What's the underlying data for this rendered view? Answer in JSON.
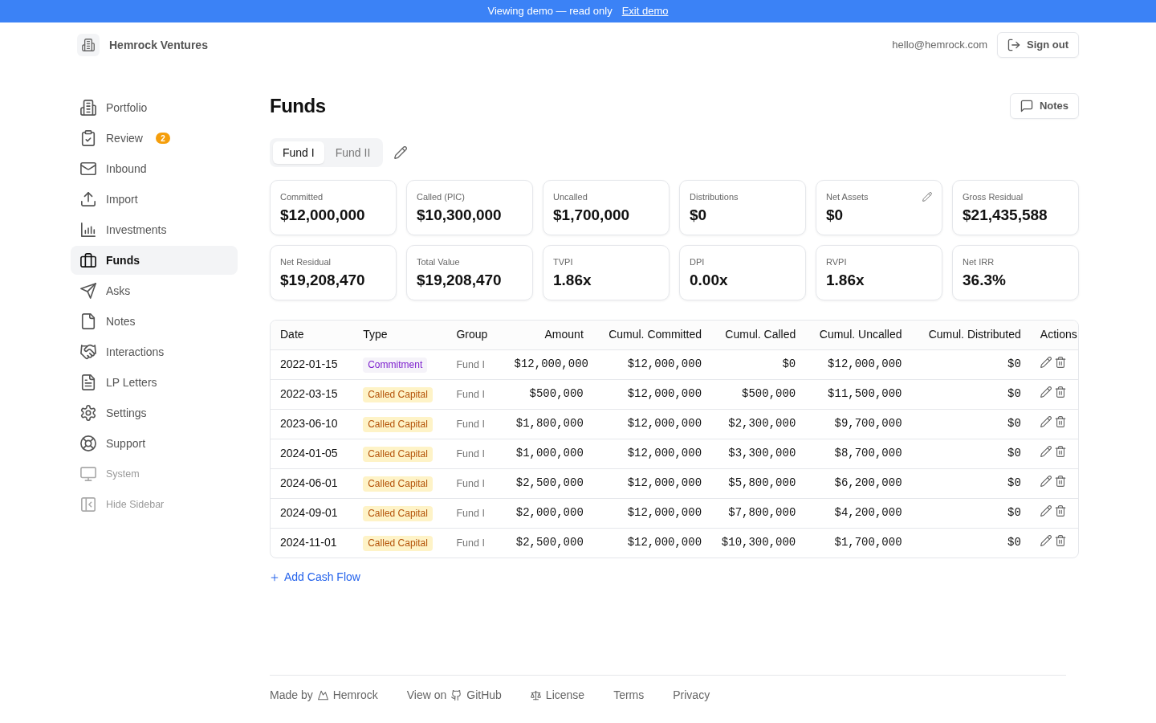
{
  "demo_banner": {
    "text": "Viewing demo — read only",
    "link": "Exit demo"
  },
  "header": {
    "brand": "Hemrock Ventures",
    "email": "hello@hemrock.com",
    "sign_out": "Sign out"
  },
  "sidebar": {
    "items": [
      {
        "label": "Portfolio",
        "selected": false
      },
      {
        "label": "Review",
        "selected": false,
        "badge": "2"
      },
      {
        "label": "Inbound",
        "selected": false
      },
      {
        "label": "Import",
        "selected": false
      },
      {
        "label": "Investments",
        "selected": false
      },
      {
        "label": "Funds",
        "selected": true
      },
      {
        "label": "Asks",
        "selected": false
      },
      {
        "label": "Notes",
        "selected": false
      },
      {
        "label": "Interactions",
        "selected": false
      },
      {
        "label": "LP Letters",
        "selected": false
      },
      {
        "label": "Settings",
        "selected": false
      },
      {
        "label": "Support",
        "selected": false
      }
    ],
    "utility_items": [
      {
        "label": "System"
      },
      {
        "label": "Hide Sidebar"
      }
    ]
  },
  "page": {
    "title": "Funds",
    "notes_button": "Notes"
  },
  "fund_tabs": [
    {
      "label": "Fund I",
      "selected": true
    },
    {
      "label": "Fund II",
      "selected": false
    }
  ],
  "metrics": [
    {
      "label": "Committed",
      "value": "$12,000,000",
      "editable": false
    },
    {
      "label": "Called (PIC)",
      "value": "$10,300,000",
      "editable": false
    },
    {
      "label": "Uncalled",
      "value": "$1,700,000",
      "editable": false
    },
    {
      "label": "Distributions",
      "value": "$0",
      "editable": false
    },
    {
      "label": "Net Assets",
      "value": "$0",
      "editable": true
    },
    {
      "label": "Gross Residual",
      "value": "$21,435,588",
      "editable": false
    },
    {
      "label": "Net Residual",
      "value": "$19,208,470",
      "editable": false
    },
    {
      "label": "Total Value",
      "value": "$19,208,470",
      "editable": false
    },
    {
      "label": "TVPI",
      "value": "1.86x",
      "editable": false
    },
    {
      "label": "DPI",
      "value": "0.00x",
      "editable": false
    },
    {
      "label": "RVPI",
      "value": "1.86x",
      "editable": false
    },
    {
      "label": "Net IRR",
      "value": "36.3%",
      "editable": false
    }
  ],
  "table": {
    "columns": [
      "Date",
      "Type",
      "Group",
      "Amount",
      "Cumul. Committed",
      "Cumul. Called",
      "Cumul. Uncalled",
      "Cumul. Distributed",
      "Actions"
    ],
    "rows": [
      {
        "date": "2022-01-15",
        "type": "Commitment",
        "kind": "commitment",
        "group": "Fund I",
        "amount": "$12,000,000",
        "cumul_committed": "$12,000,000",
        "cumul_called": "$0",
        "cumul_uncalled": "$12,000,000",
        "cumul_distributed": "$0"
      },
      {
        "date": "2022-03-15",
        "type": "Called Capital",
        "kind": "called_capital",
        "group": "Fund I",
        "amount": "$500,000",
        "cumul_committed": "$12,000,000",
        "cumul_called": "$500,000",
        "cumul_uncalled": "$11,500,000",
        "cumul_distributed": "$0"
      },
      {
        "date": "2023-06-10",
        "type": "Called Capital",
        "kind": "called_capital",
        "group": "Fund I",
        "amount": "$1,800,000",
        "cumul_committed": "$12,000,000",
        "cumul_called": "$2,300,000",
        "cumul_uncalled": "$9,700,000",
        "cumul_distributed": "$0"
      },
      {
        "date": "2024-01-05",
        "type": "Called Capital",
        "kind": "called_capital",
        "group": "Fund I",
        "amount": "$1,000,000",
        "cumul_committed": "$12,000,000",
        "cumul_called": "$3,300,000",
        "cumul_uncalled": "$8,700,000",
        "cumul_distributed": "$0"
      },
      {
        "date": "2024-06-01",
        "type": "Called Capital",
        "kind": "called_capital",
        "group": "Fund I",
        "amount": "$2,500,000",
        "cumul_committed": "$12,000,000",
        "cumul_called": "$5,800,000",
        "cumul_uncalled": "$6,200,000",
        "cumul_distributed": "$0"
      },
      {
        "date": "2024-09-01",
        "type": "Called Capital",
        "kind": "called_capital",
        "group": "Fund I",
        "amount": "$2,000,000",
        "cumul_committed": "$12,000,000",
        "cumul_called": "$7,800,000",
        "cumul_uncalled": "$4,200,000",
        "cumul_distributed": "$0"
      },
      {
        "date": "2024-11-01",
        "type": "Called Capital",
        "kind": "called_capital",
        "group": "Fund I",
        "amount": "$2,500,000",
        "cumul_committed": "$12,000,000",
        "cumul_called": "$10,300,000",
        "cumul_uncalled": "$1,700,000",
        "cumul_distributed": "$0"
      }
    ]
  },
  "add_cash_flow": "Add Cash Flow",
  "footer": {
    "links": [
      {
        "prefix": "Made by",
        "label": "Hemrock"
      },
      {
        "prefix": "View on",
        "label": "GitHub"
      },
      {
        "label": "License"
      },
      {
        "label": "Terms"
      },
      {
        "label": "Privacy"
      }
    ]
  }
}
